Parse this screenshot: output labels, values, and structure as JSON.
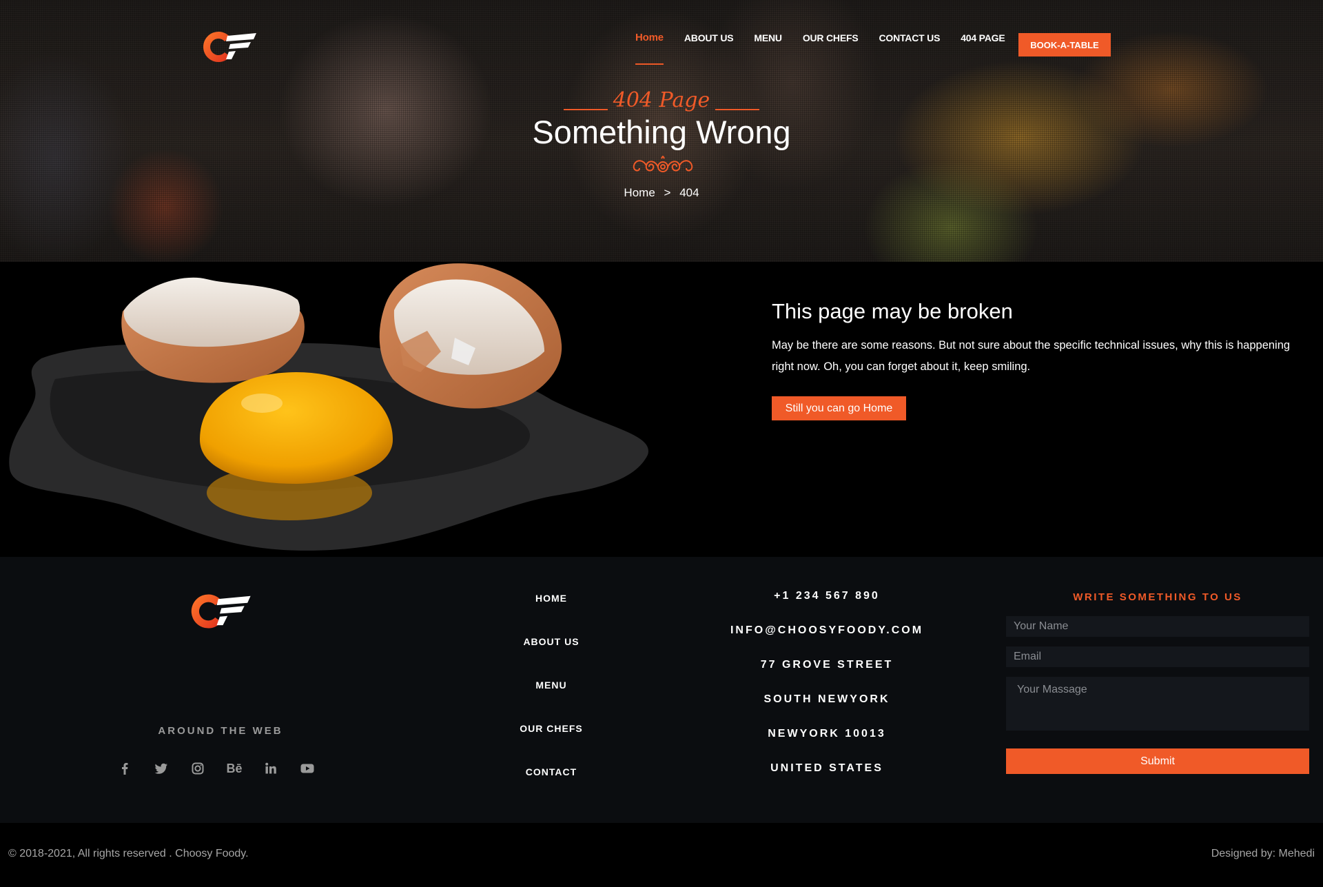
{
  "colors": {
    "accent": "#f05a28",
    "footer_bg": "#0b0d10",
    "muted": "#9a9a9a"
  },
  "header": {
    "logo_icon": "choosy-foody-logo",
    "nav": [
      {
        "label": "Home",
        "active": true
      },
      {
        "label": "ABOUT US"
      },
      {
        "label": "MENU"
      },
      {
        "label": "OUR CHEFS"
      },
      {
        "label": "CONTACT US"
      },
      {
        "label": "404 PAGE"
      }
    ],
    "cta_label": "BOOK-A-TABLE"
  },
  "hero": {
    "subtitle": "404 Page",
    "title": "Something Wrong",
    "breadcrumb": {
      "home": "Home",
      "separator": ">",
      "current": "404"
    }
  },
  "error": {
    "image_icon": "broken-egg-illustration",
    "heading": "This page may be broken",
    "text": "May be there are some reasons. But not sure about the specific technical issues, why this is happening right now. Oh, you can forget about it, keep smiling.",
    "button_label": "Still you can go Home"
  },
  "footer": {
    "logo_icon": "choosy-foody-logo",
    "around_label": "AROUND THE WEB",
    "socials": [
      "facebook-icon",
      "twitter-icon",
      "instagram-icon",
      "behance-icon",
      "linkedin-icon",
      "youtube-icon"
    ],
    "behance_glyph": "Bē",
    "links": [
      "HOME",
      "ABOUT US",
      "MENU",
      "OUR CHEFS",
      "CONTACT"
    ],
    "contact": [
      "+1 234 567 890",
      "INFO@CHOOSYFOODY.COM",
      "77 GROVE STREET",
      "SOUTH NEWYORK",
      "NEWYORK 10013",
      "UNITED STATES"
    ],
    "form": {
      "title": "WRITE SOMETHING TO US",
      "name_placeholder": "Your Name",
      "email_placeholder": "Email",
      "message_placeholder": "Your Massage",
      "submit_label": "Submit"
    }
  },
  "bottom": {
    "copyright": "© 2018-2021, All rights reserved . Choosy Foody.",
    "credit": "Designed by: Mehedi"
  }
}
